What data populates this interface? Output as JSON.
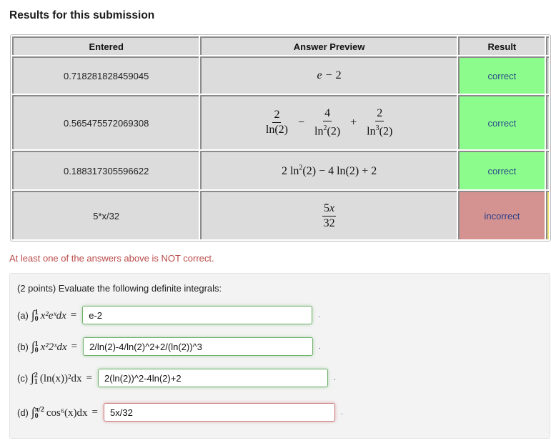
{
  "page": {
    "title": "Results for this submission"
  },
  "results_table": {
    "headers": {
      "entered": "Entered",
      "preview": "Answer Preview",
      "result": "Result"
    },
    "rows": [
      {
        "entered": "0.718281828459045",
        "preview": "e − 2",
        "result": "correct"
      },
      {
        "entered": "0.565475572069308",
        "preview": "2/ln(2) − 4/ln²(2) + 2/ln³(2)",
        "preview_parts": {
          "n1": "2",
          "d1": "ln(2)",
          "op1": "−",
          "n2": "4",
          "d2": "ln",
          "d2sup": "2",
          "d2tail": "(2)",
          "op2": "+",
          "n3": "2",
          "d3": "ln",
          "d3sup": "3",
          "d3tail": "(2)"
        },
        "result": "correct"
      },
      {
        "entered": "0.188317305596622",
        "preview": "2 ln²(2) − 4 ln(2) + 2",
        "preview_parts": {
          "a": "2 ln",
          "sup": "2",
          "b": "(2) − 4 ln(2) + 2"
        },
        "result": "correct"
      },
      {
        "entered": "5*x/32",
        "preview": "5x/32",
        "preview_parts": {
          "num": "5",
          "num_var": "x",
          "den": "32"
        },
        "result": "incorrect"
      }
    ]
  },
  "status_message": "At least one of the answers above is NOT correct.",
  "problem": {
    "prompt": "(2 points) Evaluate the following definite integrals:",
    "parts": [
      {
        "label": "(a)",
        "lower": "0",
        "upper": "1",
        "integrand": "x²eˣdx",
        "answer": "e-2",
        "status": "correct"
      },
      {
        "label": "(b)",
        "lower": "0",
        "upper": "1",
        "integrand": "x²2ˣdx",
        "answer": "2/ln(2)-4/ln(2)^2+2/(ln(2))^3",
        "status": "correct"
      },
      {
        "label": "(c)",
        "lower": "1",
        "upper": "2",
        "integrand": "(ln(x))²dx",
        "answer": "2(ln(2))^2-4ln(2)+2",
        "status": "correct"
      },
      {
        "label": "(d)",
        "lower": "0",
        "upper": "π/2",
        "integrand": "cos⁶(x)dx",
        "answer": "5x/32",
        "status": "incorrect"
      }
    ],
    "equals": "=",
    "period": "."
  },
  "colors": {
    "correct": "#8cfd8c",
    "incorrect": "#d49390",
    "warning_text": "#b94a48"
  }
}
